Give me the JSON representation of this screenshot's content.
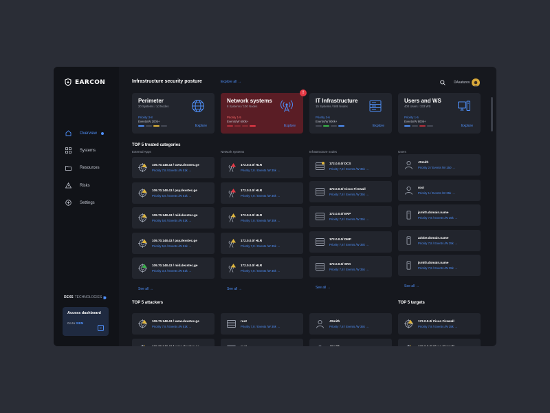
{
  "brand": {
    "name": "EARCON"
  },
  "nav": [
    {
      "label": "Overview",
      "icon": "home-icon"
    },
    {
      "label": "Systems",
      "icon": "grid-icon"
    },
    {
      "label": "Resources",
      "icon": "folder-icon"
    },
    {
      "label": "Risks",
      "icon": "warning-icon"
    },
    {
      "label": "Settings",
      "icon": "gear-icon"
    }
  ],
  "footer_brand": {
    "bold": "DEXS",
    "light": "TECHNOLOGIES"
  },
  "access": {
    "title": "Access dashboard",
    "goto": "Go to",
    "target": "SIEM"
  },
  "header": {
    "title": "Infrastructure security posture",
    "explore_all": "Explore all →",
    "user": "DAsaturov"
  },
  "cards": [
    {
      "title": "Perimeter",
      "sub": "20 Systems / 1d Nodes",
      "priority": "Priority 3-8",
      "events": "Events/W 200k+",
      "explore": "Explore",
      "bar_colors": [
        "#4e8ef7",
        "#454a56",
        "#e0b63c",
        "#454a56"
      ]
    },
    {
      "title": "Network systems",
      "sub": "8 Systems / 100 Nodes",
      "priority": "Priority 1-5",
      "events": "Events/W 600k+",
      "explore": "Explore",
      "badge": "!",
      "bar_colors": [
        "#b1303c",
        "#8a2a33",
        "#8a2a33",
        "#e53945"
      ]
    },
    {
      "title": "IT Infrastructure",
      "sub": "15 Systems / 585 Nodes",
      "priority": "Priority 3-6",
      "events": "Events/W 900k+",
      "explore": "Explore",
      "bar_colors": [
        "#454a56",
        "#39b34a",
        "#454a56",
        "#4e8ef7"
      ]
    },
    {
      "title": "Users and WS",
      "sub": "400 Users / 333 WS",
      "priority": "Priority 1-5",
      "events": "Events/W 900k+",
      "explore": "Explore",
      "bar_colors": [
        "#4e8ef7",
        "#454a56",
        "#b1303c",
        "#454a56"
      ]
    }
  ],
  "top5_treated": "TOP 5 treated categories",
  "columns": [
    "External Apps",
    "Network systems",
    "Infrastructure nodes",
    "Users"
  ],
  "treated": [
    [
      {
        "t1": "109.70.148.43 / www.dexstec.ge",
        "t2": "Priority 7,8 / Events /W 51k →"
      },
      {
        "t1": "109.70.148.43 / pay.dexstec.ge",
        "t2": "Priority 5,6 / Events /W 51k →"
      },
      {
        "t1": "109.70.148.43 / mid.dexstec.ge",
        "t2": "Priority 5,6 / Events /W 51k →"
      },
      {
        "t1": "109.70.148.43 / pay.dexstec.ge",
        "t2": "Priority 5,6 / Events /W 51k →"
      },
      {
        "t1": "109.70.148.43 / mid.dexstec.ge",
        "t2": "Priority 3,4 / Events /W 51k →"
      }
    ],
    [
      {
        "t1": "172.0.0.0/ HLR",
        "t2": "Priority 7,8 / Events /W 35k →"
      },
      {
        "t1": "172.0.0.0/ HLR",
        "t2": "Priority 7,8 / Events /W 35k →"
      },
      {
        "t1": "172.0.0.0/ HLR",
        "t2": "Priority 7,8 / Events /W 35k →"
      },
      {
        "t1": "172.0.0.0/ HLR",
        "t2": "Priority 7,8 / Events /W 35k →"
      },
      {
        "t1": "172.0.0.0/ HLR",
        "t2": "Priority 7,8 / Events /W 35k →"
      }
    ],
    [
      {
        "t1": "172.0.0.0/ DCS",
        "t2": "Priority 7,8 / Events /W 35k →"
      },
      {
        "t1": "172.0.0.0/ Cisco Firewall",
        "t2": "Priority 7,8 / Events /W 35k →"
      },
      {
        "t1": "172.0.0.0/ ERP",
        "t2": "Priority 7,8 / Events /W 35k →"
      },
      {
        "t1": "172.0.0.0/ DMP",
        "t2": "Priority 7,8 / Events /W 35k →"
      },
      {
        "t1": "172.0.0.0/ SRX",
        "t2": "Priority 7,8 / Events /W 35k →"
      }
    ],
    [
      {
        "t1": "JSmith",
        "t2": "Priority 2 / Events /W 150 →"
      },
      {
        "t1": "root",
        "t2": "Priority 1 / Events /W 35k →"
      },
      {
        "t1": "jsmith.domain.name",
        "t2": "Priority 7,8 / Events /W 35k →"
      },
      {
        "t1": "adobe.domain.name",
        "t2": "Priority 7,8 / Events /W 35k →"
      },
      {
        "t1": "jsmith.domain.name",
        "t2": "Priority 7,8 / Events /W 35k →"
      }
    ]
  ],
  "see_all": "See all →",
  "top5_attackers": "TOP 5 attackers",
  "top5_targets": "TOP 5 targets",
  "attackers": [
    [
      {
        "t1": "109.70.148.43 / www.dexstec.ge",
        "t2": "Priority 7,8 / Events /W 51k →"
      },
      {
        "t1": "109.70.148.43 / www.dexstec.ge",
        "t2": ""
      }
    ],
    [
      {
        "t1": "root",
        "t2": "Priority 7,8 / Events /W 35k →"
      },
      {
        "t1": "root",
        "t2": ""
      }
    ],
    [
      {
        "t1": "JSmith",
        "t2": "Priority 7,8 / Events /W 35k →"
      },
      {
        "t1": "JSmith",
        "t2": ""
      }
    ],
    [
      {
        "t1": "172.0.0.0/ Cisco Firewall",
        "t2": "Priority 7,8 / Events /W 35k →"
      },
      {
        "t1": "172.0.0.0/ Cisco Firewall",
        "t2": ""
      }
    ]
  ]
}
